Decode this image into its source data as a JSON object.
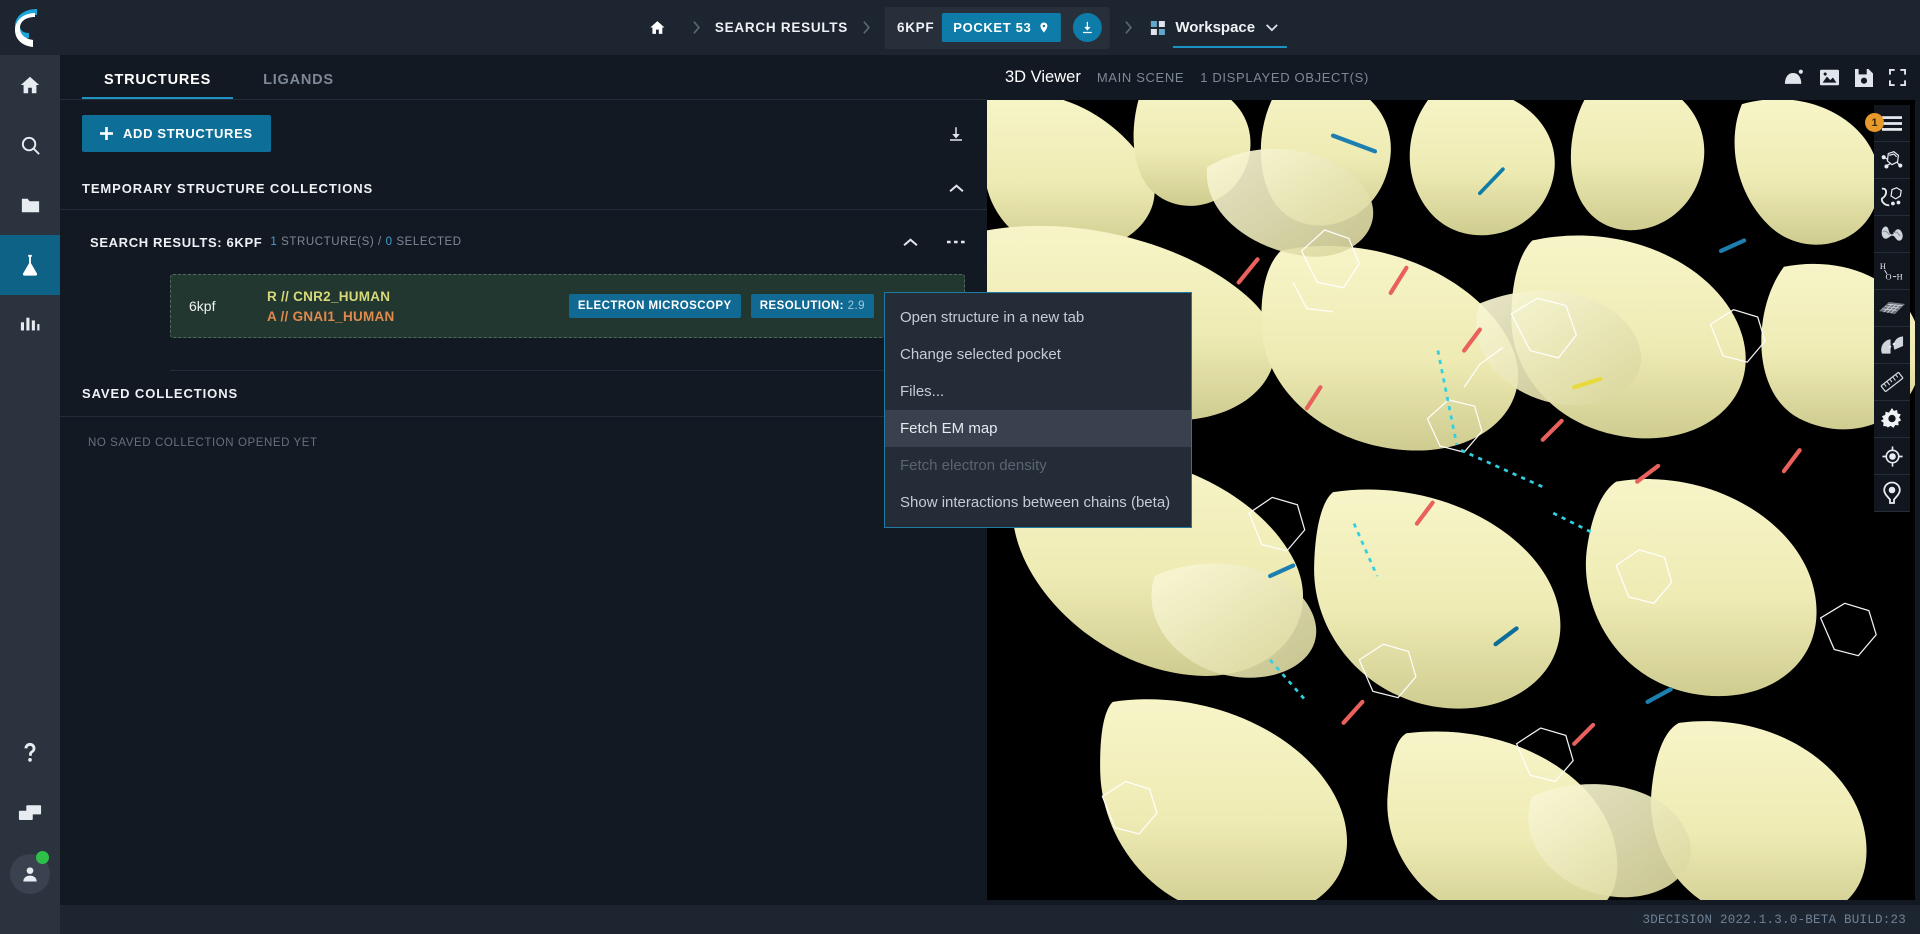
{
  "topbar": {
    "home_icon": "home-icon",
    "breadcrumb_search": "SEARCH RESULTS",
    "pdb_id": "6KPF",
    "pocket_label": "POCKET 53",
    "download_icon": "download-icon",
    "workspace_label": "Workspace",
    "workspace_caret": "chevron-down-icon"
  },
  "rail": {
    "items": [
      {
        "name": "home-icon",
        "label": "Home",
        "active": false
      },
      {
        "name": "search-icon",
        "label": "Search",
        "active": false
      },
      {
        "name": "folder-icon",
        "label": "Projects",
        "active": false
      },
      {
        "name": "flask-icon",
        "label": "Structures",
        "active": true
      },
      {
        "name": "chart-icon",
        "label": "Analytics",
        "active": false
      }
    ],
    "bottom": [
      {
        "name": "help-icon",
        "label": "Help"
      },
      {
        "name": "chat-icon",
        "label": "Messages"
      },
      {
        "name": "avatar",
        "label": "Account"
      }
    ]
  },
  "left_panel": {
    "tabs": [
      {
        "label": "STRUCTURES",
        "active": true
      },
      {
        "label": "LIGANDS",
        "active": false
      }
    ],
    "add_button": "ADD STRUCTURES",
    "export_icon": "download-icon",
    "temp_section_title": "TEMPORARY STRUCTURE COLLECTIONS",
    "temp_collapse_icon": "chevron-up-icon",
    "collection": {
      "name": "SEARCH RESULTS: 6KPF",
      "meta_count": "1",
      "meta_count_label": " STRUCTURE(S) / ",
      "meta_selected": "0",
      "meta_selected_label": " SELECTED",
      "collapse_icon": "chevron-up-icon",
      "more_icon": "more-horizontal-icon"
    },
    "structure_card": {
      "pdb": "6kpf",
      "chain_1": "R // CNR2_HUMAN",
      "chain_2": "A // GNAI1_HUMAN",
      "method_tag": "ELECTRON MICROSCOPY",
      "resolution_label": "RESOLUTION:",
      "resolution_value": "2.9",
      "eye_icon": "eye-icon",
      "info_icon": "info-icon"
    },
    "saved_section_title": "SAVED COLLECTIONS",
    "saved_empty": "NO SAVED COLLECTION OPENED YET"
  },
  "viewer": {
    "title": "3D Viewer",
    "scene": "MAIN SCENE",
    "objects": "1 DISPLAYED OBJECT(S)",
    "head_tools": [
      {
        "name": "hide-surface-icon"
      },
      {
        "name": "image-export-icon"
      },
      {
        "name": "save-icon"
      },
      {
        "name": "fullscreen-icon"
      }
    ],
    "toolbar": [
      {
        "name": "menu-icon",
        "badge": "1"
      },
      {
        "name": "molecule-icon",
        "badge": ""
      },
      {
        "name": "ligand-interaction-icon",
        "badge": ""
      },
      {
        "name": "ribbon-icon",
        "badge": ""
      },
      {
        "name": "water-icon",
        "badge": ""
      },
      {
        "name": "surface-grid-icon",
        "badge": ""
      },
      {
        "name": "contacts-icon",
        "badge": ""
      },
      {
        "name": "ruler-icon",
        "badge": ""
      },
      {
        "name": "settings-gear-icon",
        "badge": ""
      },
      {
        "name": "center-target-icon",
        "badge": ""
      },
      {
        "name": "pocket-pin-icon",
        "badge": ""
      }
    ]
  },
  "context_menu": {
    "items": [
      {
        "label": "Open structure in a new tab",
        "state": "normal"
      },
      {
        "label": "Change selected pocket",
        "state": "normal"
      },
      {
        "label": "Files...",
        "state": "normal"
      },
      {
        "label": "Fetch EM map",
        "state": "hover"
      },
      {
        "label": "Fetch electron density",
        "state": "disabled"
      },
      {
        "label": "Show interactions between chains (beta)",
        "state": "normal"
      }
    ]
  },
  "statusbar": {
    "version": "3DECISION 2022.1.3.0-BETA BUILD:23"
  },
  "colors": {
    "accent": "#0d7ca8",
    "accent_dark": "#0d6286",
    "panel_bg": "#131923",
    "topbar_bg": "#1d2530",
    "rail_bg": "#2a333e",
    "card_bg": "#22372f",
    "chain_a": "#d6d87a",
    "chain_b": "#e08a4e",
    "badge": "#e79a2b",
    "online": "#2fc04a"
  }
}
